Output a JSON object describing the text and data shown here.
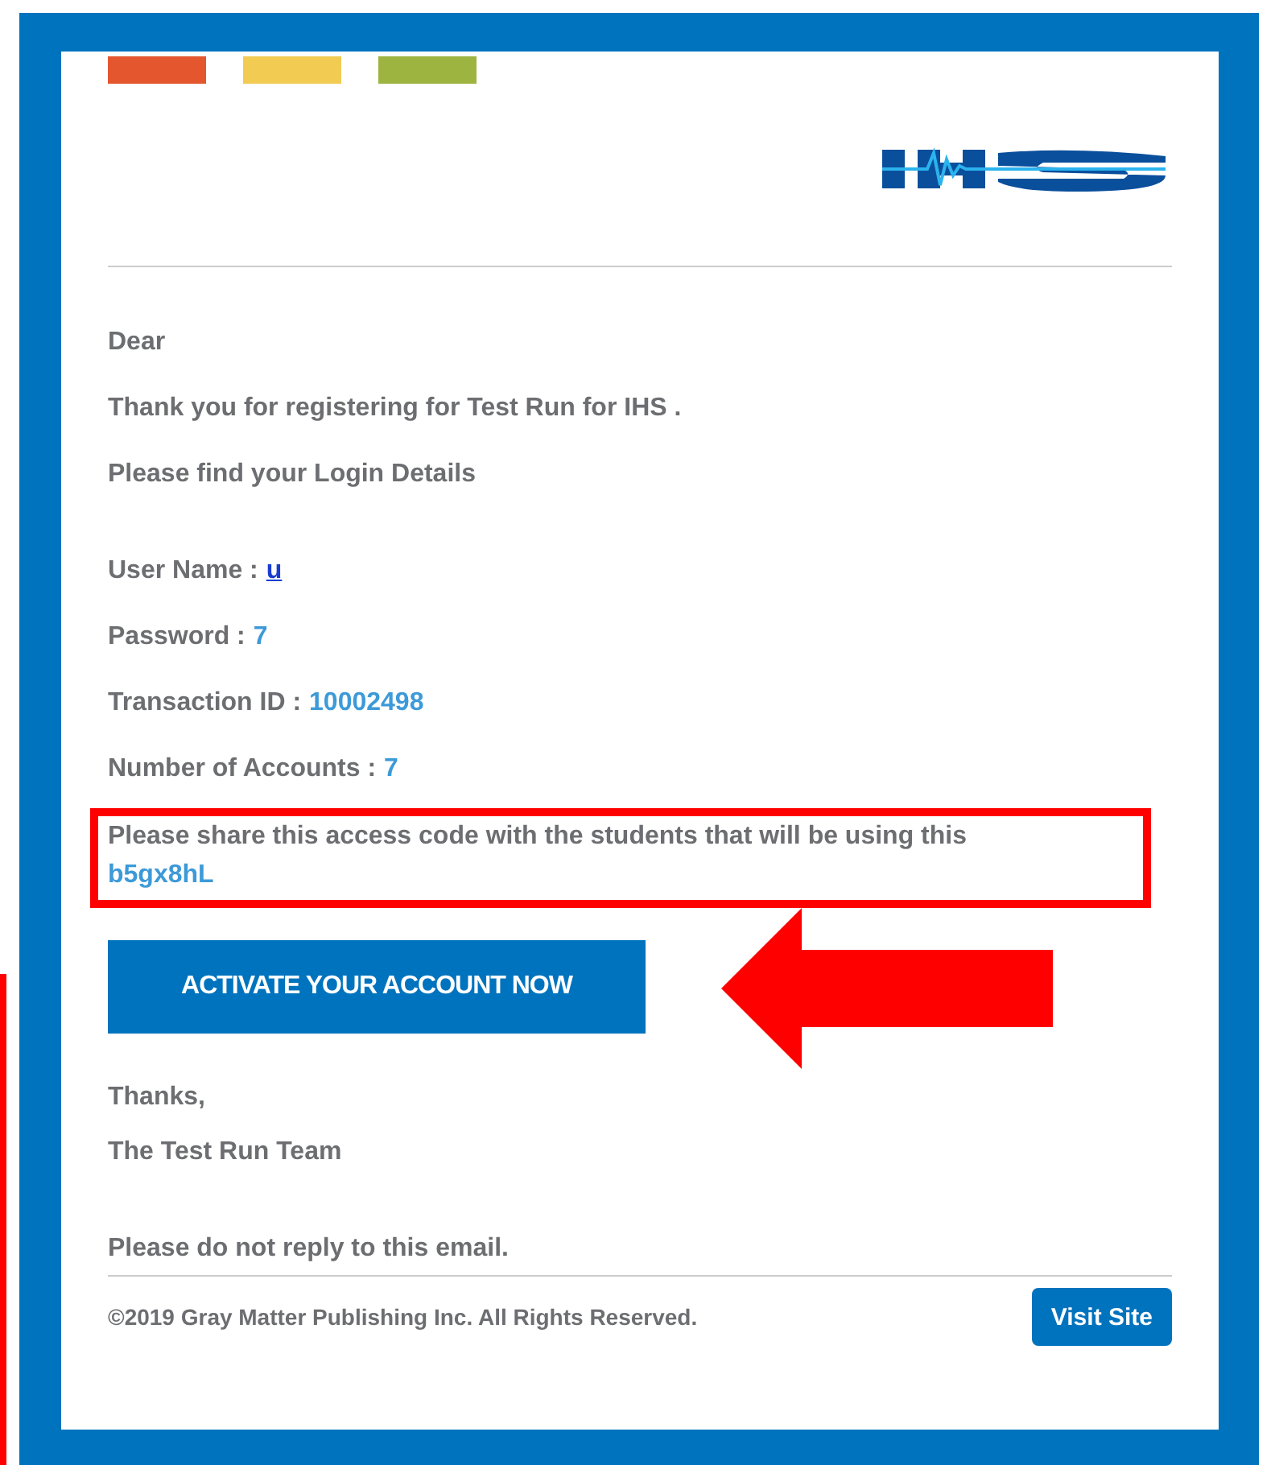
{
  "header": {
    "color_bars": [
      {
        "color": "#e4572e"
      },
      {
        "color": "#f2cb52"
      },
      {
        "color": "#9db441"
      }
    ]
  },
  "greeting": "Dear",
  "intro": "Thank you for registering for **Test Run for IHS .**",
  "login_heading": "Please find your Login Details",
  "details": [
    {
      "label": "User Name :",
      "value": "u",
      "kind": "link"
    },
    {
      "label": "Password :",
      "value": "7",
      "kind": "plain"
    },
    {
      "label": "Transaction ID :",
      "value": "10002498",
      "kind": "plain"
    },
    {
      "label": "Number of Accounts :",
      "value": "7",
      "kind": "plain"
    }
  ],
  "access_code": {
    "text": "Please share this access code with the students that will be using this",
    "code": "b5gx8hL"
  },
  "activate_button": "ACTIVATE YOUR ACCOUNT NOW",
  "signoff": [
    "Thanks,",
    "The Test Run Team"
  ],
  "no_reply": "Please do not reply to this email.",
  "footer": {
    "copyright": "©2019 Gray Matter Publishing Inc. All Rights Reserved.",
    "visit_button": "Visit Site"
  }
}
